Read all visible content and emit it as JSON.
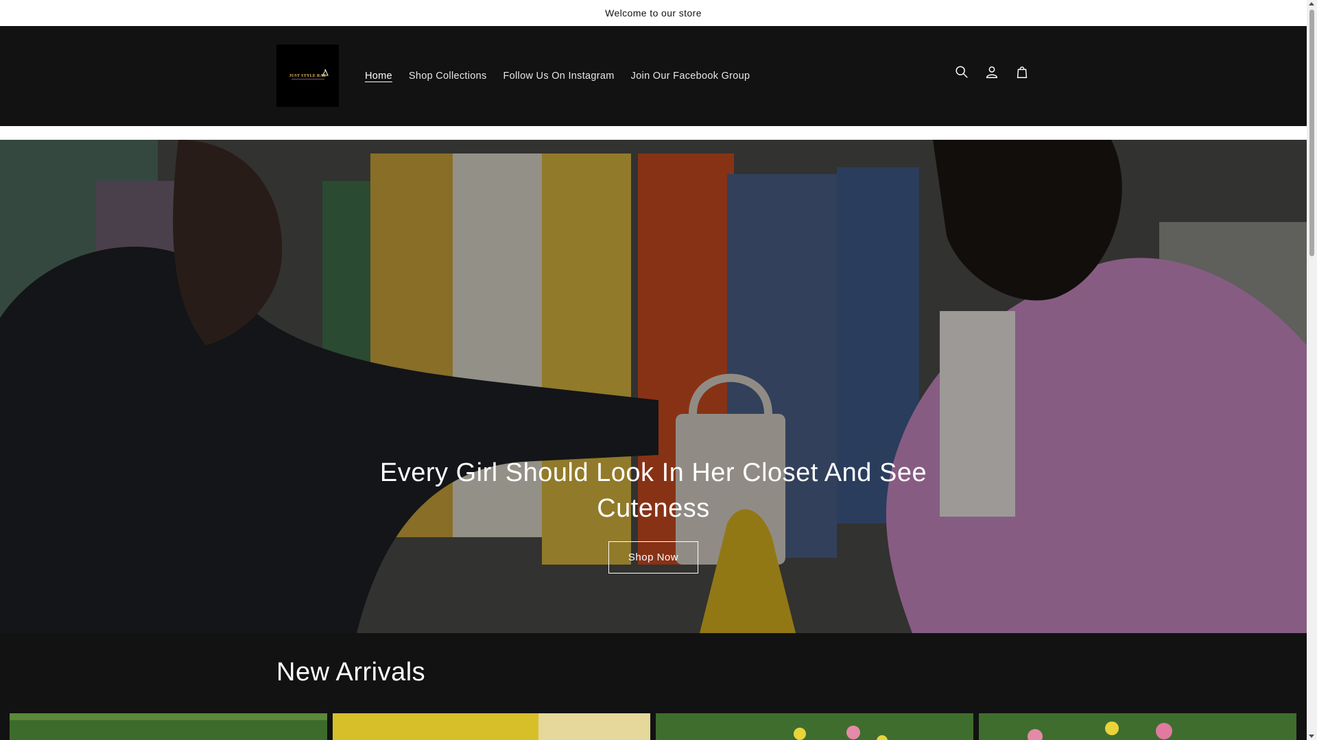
{
  "announcement": {
    "text": "Welcome to our store"
  },
  "header": {
    "logo_text": "JUST STYLE RAE",
    "nav": [
      {
        "label": "Home",
        "active": true
      },
      {
        "label": "Shop Collections",
        "active": false
      },
      {
        "label": "Follow Us On Instagram",
        "active": false
      },
      {
        "label": "Join Our Facebook Group",
        "active": false
      }
    ],
    "icons": [
      "search-icon",
      "account-icon",
      "cart-icon"
    ]
  },
  "hero": {
    "title": "Every Girl Should Look In Her Closet And See Cuteness",
    "button_label": "Shop Now"
  },
  "new_arrivals": {
    "title": "New Arrivals",
    "products": [
      {
        "image": "green-grass-backdrop"
      },
      {
        "image": "yellow-backdrop"
      },
      {
        "image": "grass-with-flowers-backdrop"
      },
      {
        "image": "grass-with-roses-backdrop"
      }
    ]
  },
  "colors": {
    "background": "#121212",
    "announcement_bg": "#ffffff",
    "text": "#ffffff"
  }
}
